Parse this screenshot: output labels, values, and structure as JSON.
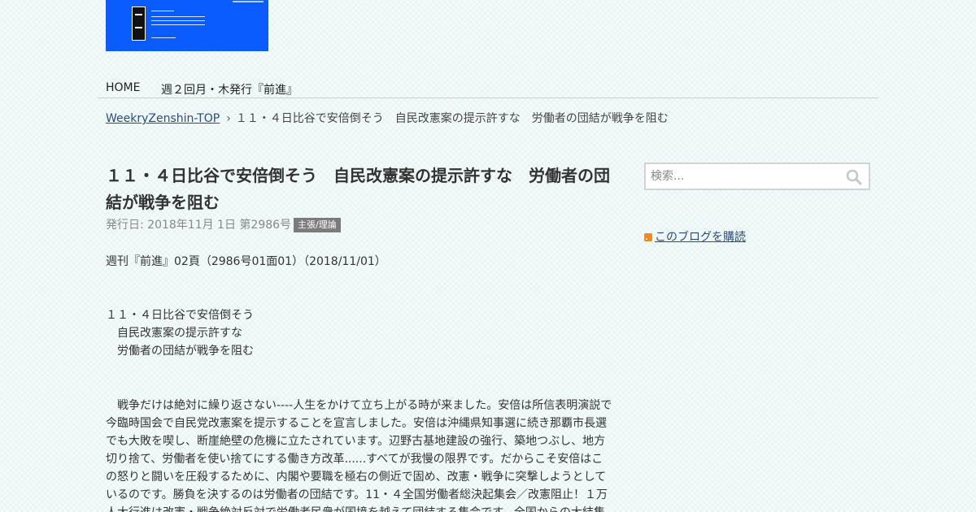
{
  "nav": {
    "home": "HOME",
    "weekly": "週２回月・木発行『前進』"
  },
  "breadcrumb": {
    "root": "WeekryZenshin-TOP",
    "separator": "›",
    "current": "１１・４日比谷で安倍倒そう　自民改憲案の提示許すな　労働者の団結が戦争を阻む"
  },
  "post": {
    "title": "１１・４日比谷で安倍倒そう　自民改憲案の提示許すな　労働者の団結が戦争を阻む",
    "meta": "発行日: 2018年11月 1日 第2986号",
    "category": "主張/理論",
    "issue_line": "週刊『前進』02頁（2986号01面01）（2018/11/01）",
    "headline_lines": [
      "１１・４日比谷で安倍倒そう",
      "　自民改憲案の提示許すな",
      "　労働者の団結が戦争を阻む"
    ],
    "body": "　戦争だけは絶対に繰り返さない----人生をかけて立ち上がる時が来ました。安倍は所信表明演説で今臨時国会で自民党改憲案を提示することを宣言しました。安倍は沖縄県知事選に続き那覇市長選でも大敗を喫し、断崖絶壁の危機に立たされています。辺野古基地建設の強行、築地つぶし、地方切り捨て、労働者を使い捨てにする働き方改革......すべてが我慢の限界です。だからこそ安倍はこの怒りと闘いを圧殺するために、内閣や要職を極右の側近で固め、改憲・戦争に突撃しようとしているのです。勝負を決するのは労働者の団結です。11・４全国労働者総決起集会／改憲阻止！１万人大行進は改憲・戦争絶対反対で労働者民衆が国境を越えて団結する集会です。全国からの大結集"
  },
  "sidebar": {
    "search_placeholder": "検索...",
    "subscribe": "このブログを購読"
  },
  "colors": {
    "logo_bg": "#0a5cff",
    "link": "#2b4b7d",
    "badge_bg": "#7b7b7b",
    "rss": "#f08a24"
  }
}
